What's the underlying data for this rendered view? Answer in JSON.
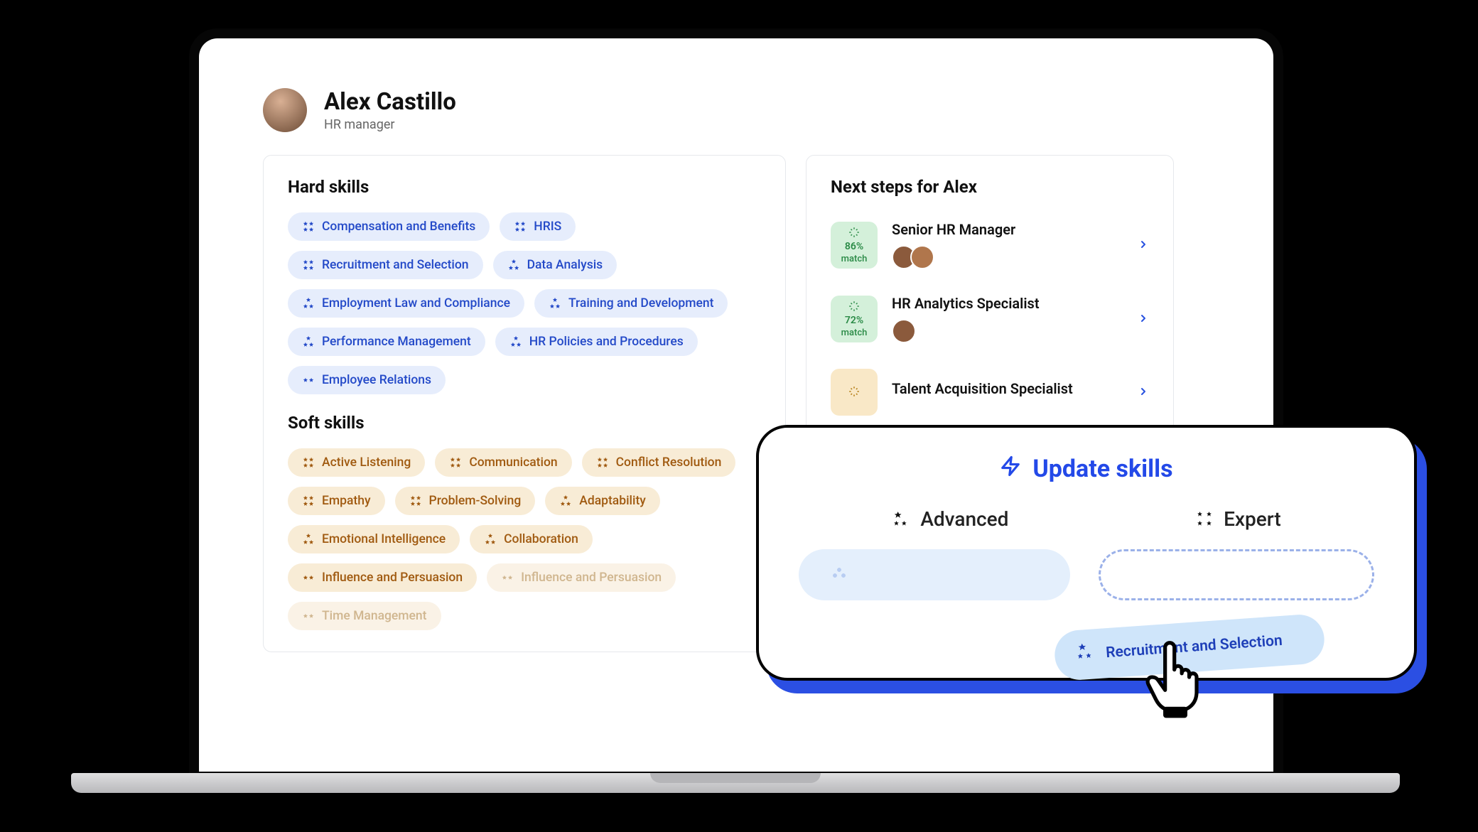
{
  "profile": {
    "name": "Alex Castillo",
    "role": "HR manager"
  },
  "hardSkills": {
    "title": "Hard skills",
    "items": [
      {
        "label": "Compensation and Benefits",
        "level": "expert"
      },
      {
        "label": "HRIS",
        "level": "expert"
      },
      {
        "label": "Recruitment and Selection",
        "level": "expert"
      },
      {
        "label": "Data Analysis",
        "level": "advanced"
      },
      {
        "label": "Employment Law and Compliance",
        "level": "advanced"
      },
      {
        "label": "Training and Development",
        "level": "advanced"
      },
      {
        "label": "Performance Management",
        "level": "advanced"
      },
      {
        "label": "HR Policies and Procedures",
        "level": "advanced"
      },
      {
        "label": "Employee Relations",
        "level": "intermediate"
      }
    ]
  },
  "softSkills": {
    "title": "Soft skills",
    "items": [
      {
        "label": "Active Listening",
        "level": "expert",
        "muted": false
      },
      {
        "label": "Communication",
        "level": "expert",
        "muted": false
      },
      {
        "label": "Conflict Resolution",
        "level": "expert",
        "muted": false
      },
      {
        "label": "Empathy",
        "level": "expert",
        "muted": false
      },
      {
        "label": "Problem-Solving",
        "level": "expert",
        "muted": false
      },
      {
        "label": "Adaptability",
        "level": "advanced",
        "muted": false
      },
      {
        "label": "Emotional Intelligence",
        "level": "advanced",
        "muted": false
      },
      {
        "label": "Collaboration",
        "level": "advanced",
        "muted": false
      },
      {
        "label": "Influence and Persuasion",
        "level": "intermediate",
        "muted": false
      },
      {
        "label": "Influence and Persuasion",
        "level": "intermediate",
        "muted": true
      },
      {
        "label": "Time Management",
        "level": "intermediate",
        "muted": true
      }
    ]
  },
  "nextSteps": {
    "title": "Next steps for Alex",
    "items": [
      {
        "title": "Senior HR Manager",
        "match": "86%",
        "matchLabel": "match",
        "tone": "green",
        "avatars": 2
      },
      {
        "title": "HR Analytics Specialist",
        "match": "72%",
        "matchLabel": "match",
        "tone": "green",
        "avatars": 1
      },
      {
        "title": "Talent Acquisition Specialist",
        "match": "",
        "matchLabel": "",
        "tone": "amber",
        "avatars": 0
      }
    ]
  },
  "modal": {
    "title": "Update skills",
    "levels": {
      "advanced": "Advanced",
      "expert": "Expert"
    },
    "dragChip": "Recruitment and Selection"
  }
}
